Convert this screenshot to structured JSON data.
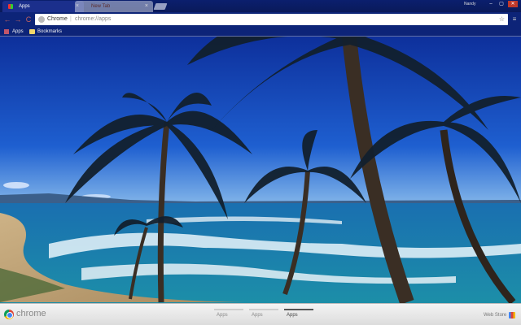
{
  "tabs": [
    {
      "label": "Apps",
      "active": true
    },
    {
      "label": "New Tab",
      "active": false
    }
  ],
  "window": {
    "user": "Nandy",
    "minimize": "–",
    "maximize": "▢",
    "close": "✕"
  },
  "toolbar": {
    "back": "←",
    "forward": "→",
    "reload": "C",
    "omnibox_scheme": "Chrome",
    "omnibox_url": "chrome://apps",
    "star": "☆",
    "menu": "≡"
  },
  "bookmarks": {
    "apps_label": "Apps",
    "bookmarks_label": "Bookmarks"
  },
  "bottom": {
    "logo": "chrome",
    "pages": [
      "Apps",
      "Apps",
      "Apps"
    ],
    "active_page": 2,
    "web_store": "Web Store"
  },
  "colors": {
    "sky": "#0a2a8a",
    "sea": "#1a6fb0",
    "sand": "#d9c29a",
    "frame": "#0d2478"
  }
}
